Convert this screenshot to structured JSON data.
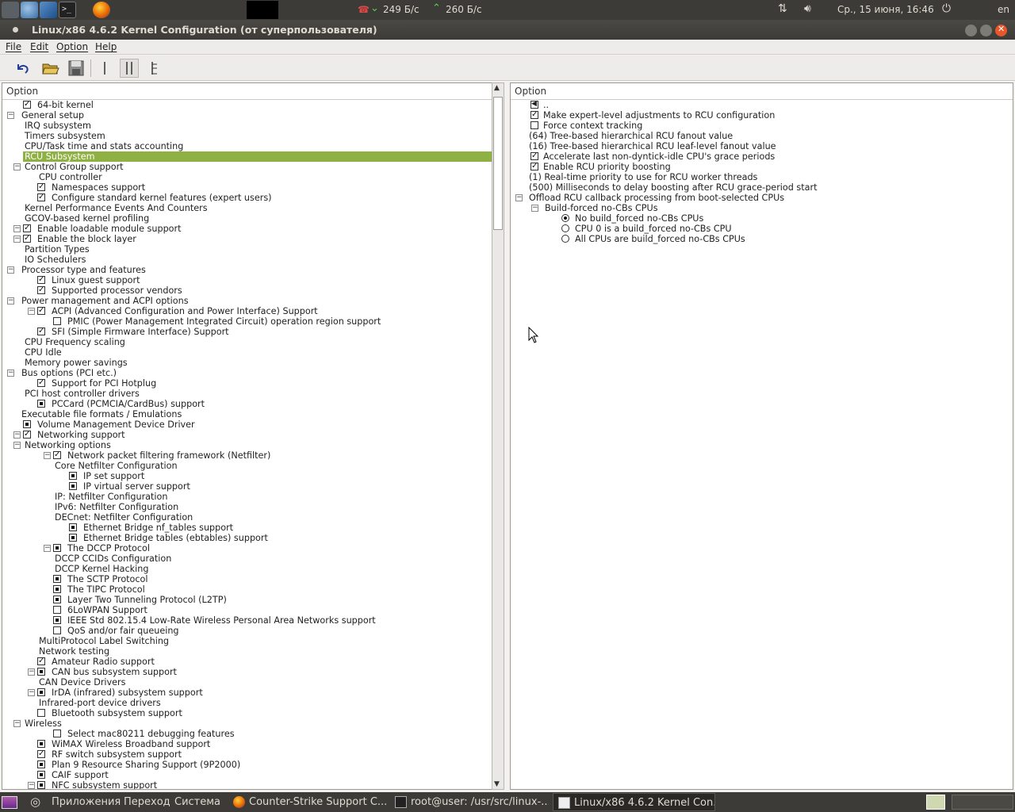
{
  "top_panel": {
    "net_down": "249 Б/с",
    "net_up": "260 Б/с",
    "datetime": "Ср., 15 июня, 16:46",
    "lang": "en",
    "launchers": [
      "steam-icon",
      "browser-icon",
      "virtualbox-icon",
      "terminal-icon",
      "firefox-icon"
    ]
  },
  "window": {
    "title": "Linux/x86 4.6.2 Kernel Configuration (от суперпользователя)"
  },
  "menu": {
    "file": "File",
    "edit": "Edit",
    "option": "Option",
    "help": "Help"
  },
  "toolbar": {
    "buttons": [
      "back-icon",
      "open-icon",
      "save-icon",
      "single-view-icon",
      "split-view-icon",
      "full-tree-icon"
    ]
  },
  "left_pane": {
    "header": "Option",
    "rows": [
      {
        "label": "64-bit kernel",
        "level": 1,
        "check": "on",
        "expander": null
      },
      {
        "label": "General setup",
        "level": 0,
        "check": null,
        "expander": "minus"
      },
      {
        "label": "IRQ subsystem",
        "level": 1,
        "check": null,
        "expander": null
      },
      {
        "label": "Timers subsystem",
        "level": 1,
        "check": null,
        "expander": null
      },
      {
        "label": "CPU/Task time and stats accounting",
        "level": 1,
        "check": null,
        "expander": null
      },
      {
        "label": "RCU Subsystem",
        "level": 1,
        "check": null,
        "expander": null,
        "selected": true
      },
      {
        "label": "Control Group support",
        "level": 1,
        "check": null,
        "expander": "minus"
      },
      {
        "label": "CPU controller",
        "level": 2,
        "check": null,
        "expander": null
      },
      {
        "label": "Namespaces support",
        "level": 2,
        "check": "on",
        "expander": null
      },
      {
        "label": "Configure standard kernel features (expert users)",
        "level": 2,
        "check": "on",
        "expander": null
      },
      {
        "label": "Kernel Performance Events And Counters",
        "level": 1,
        "check": null,
        "expander": null
      },
      {
        "label": "GCOV-based kernel profiling",
        "level": 1,
        "check": null,
        "expander": null
      },
      {
        "label": "Enable loadable module support",
        "level": 1,
        "check": "on",
        "expander": "minus"
      },
      {
        "label": "Enable the block layer",
        "level": 1,
        "check": "on",
        "expander": "minus"
      },
      {
        "label": "Partition Types",
        "level": 1,
        "check": null,
        "expander": null
      },
      {
        "label": "IO Schedulers",
        "level": 1,
        "check": null,
        "expander": null
      },
      {
        "label": "Processor type and features",
        "level": 0,
        "check": null,
        "expander": "minus"
      },
      {
        "label": "Linux guest support",
        "level": 2,
        "check": "on",
        "expander": null
      },
      {
        "label": "Supported processor vendors",
        "level": 2,
        "check": "on",
        "expander": null
      },
      {
        "label": "Power management and ACPI options",
        "level": 0,
        "check": null,
        "expander": "minus"
      },
      {
        "label": "ACPI (Advanced Configuration and Power Interface) Support",
        "level": 2,
        "check": "on",
        "expander": "minus"
      },
      {
        "label": "PMIC (Power Management Integrated Circuit) operation region support",
        "level": 3,
        "check": "off",
        "expander": null
      },
      {
        "label": "SFI (Simple Firmware Interface) Support",
        "level": 2,
        "check": "on",
        "expander": null
      },
      {
        "label": "CPU Frequency scaling",
        "level": 1,
        "check": null,
        "expander": null
      },
      {
        "label": "CPU Idle",
        "level": 1,
        "check": null,
        "expander": null
      },
      {
        "label": "Memory power savings",
        "level": 1,
        "check": null,
        "expander": null
      },
      {
        "label": "Bus options (PCI etc.)",
        "level": 0,
        "check": null,
        "expander": "minus"
      },
      {
        "label": "Support for PCI Hotplug",
        "level": 2,
        "check": "on",
        "expander": null
      },
      {
        "label": "PCI host controller drivers",
        "level": 1,
        "check": null,
        "expander": null
      },
      {
        "label": "PCCard (PCMCIA/CardBus) support",
        "level": 2,
        "check": "mod",
        "expander": null
      },
      {
        "label": "Executable file formats / Emulations",
        "level": 0,
        "check": null,
        "expander": null
      },
      {
        "label": "Volume Management Device Driver",
        "level": 1,
        "check": "mod",
        "expander": null
      },
      {
        "label": "Networking support",
        "level": 1,
        "check": "on",
        "expander": "minus"
      },
      {
        "label": "Networking options",
        "level": 1,
        "check": null,
        "expander": "minus"
      },
      {
        "label": "Network packet filtering framework (Netfilter)",
        "level": 3,
        "check": "on",
        "expander": "minus"
      },
      {
        "label": "Core Netfilter Configuration",
        "level": 3,
        "check": null,
        "expander": null
      },
      {
        "label": "IP set support",
        "level": 4,
        "check": "mod",
        "expander": null
      },
      {
        "label": "IP virtual server support",
        "level": 4,
        "check": "mod",
        "expander": null
      },
      {
        "label": "IP: Netfilter Configuration",
        "level": 3,
        "check": null,
        "expander": null
      },
      {
        "label": "IPv6: Netfilter Configuration",
        "level": 3,
        "check": null,
        "expander": null
      },
      {
        "label": "DECnet: Netfilter Configuration",
        "level": 3,
        "check": null,
        "expander": null
      },
      {
        "label": "Ethernet Bridge nf_tables support",
        "level": 4,
        "check": "mod",
        "expander": null
      },
      {
        "label": "Ethernet Bridge tables (ebtables) support",
        "level": 4,
        "check": "mod",
        "expander": null
      },
      {
        "label": "The DCCP Protocol",
        "level": 3,
        "check": "mod",
        "expander": "minus"
      },
      {
        "label": "DCCP CCIDs Configuration",
        "level": 3,
        "check": null,
        "expander": null
      },
      {
        "label": "DCCP Kernel Hacking",
        "level": 3,
        "check": null,
        "expander": null
      },
      {
        "label": "The SCTP Protocol",
        "level": 3,
        "check": "mod",
        "expander": null
      },
      {
        "label": "The TIPC Protocol",
        "level": 3,
        "check": "mod",
        "expander": null
      },
      {
        "label": "Layer Two Tunneling Protocol (L2TP)",
        "level": 3,
        "check": "mod",
        "expander": null
      },
      {
        "label": "6LoWPAN Support",
        "level": 3,
        "check": "off",
        "expander": null
      },
      {
        "label": "IEEE Std 802.15.4 Low-Rate Wireless Personal Area Networks support",
        "level": 3,
        "check": "mod",
        "expander": null
      },
      {
        "label": "QoS and/or fair queueing",
        "level": 3,
        "check": "off",
        "expander": null
      },
      {
        "label": "MultiProtocol Label Switching",
        "level": 2,
        "check": null,
        "expander": null
      },
      {
        "label": "Network testing",
        "level": 2,
        "check": null,
        "expander": null
      },
      {
        "label": "Amateur Radio support",
        "level": 2,
        "check": "on",
        "expander": null
      },
      {
        "label": "CAN bus subsystem support",
        "level": 2,
        "check": "mod",
        "expander": "minus"
      },
      {
        "label": "CAN Device Drivers",
        "level": 2,
        "check": null,
        "expander": null
      },
      {
        "label": "IrDA (infrared) subsystem support",
        "level": 2,
        "check": "mod",
        "expander": "minus"
      },
      {
        "label": "Infrared-port device drivers",
        "level": 2,
        "check": null,
        "expander": null
      },
      {
        "label": "Bluetooth subsystem support",
        "level": 2,
        "check": "off",
        "expander": null
      },
      {
        "label": "Wireless",
        "level": 1,
        "check": null,
        "expander": "minus"
      },
      {
        "label": "Select mac80211 debugging features",
        "level": 3,
        "check": "off",
        "expander": null
      },
      {
        "label": "WiMAX Wireless Broadband support",
        "level": 2,
        "check": "mod",
        "expander": null
      },
      {
        "label": "RF switch subsystem support",
        "level": 2,
        "check": "on",
        "expander": null
      },
      {
        "label": "Plan 9 Resource Sharing Support (9P2000)",
        "level": 2,
        "check": "mod",
        "expander": null
      },
      {
        "label": "CAIF support",
        "level": 2,
        "check": "mod",
        "expander": null
      },
      {
        "label": "NFC subsystem support",
        "level": 2,
        "check": "mod",
        "expander": "minus"
      }
    ]
  },
  "right_pane": {
    "header": "Option",
    "rows": [
      {
        "label": "..",
        "kind": "back"
      },
      {
        "label": "Make expert-level adjustments to RCU configuration",
        "kind": "check",
        "state": "on"
      },
      {
        "label": "Force context tracking",
        "kind": "check",
        "state": "off"
      },
      {
        "label": "(64) Tree-based hierarchical RCU fanout value",
        "kind": "text"
      },
      {
        "label": "(16) Tree-based hierarchical RCU leaf-level fanout value",
        "kind": "text"
      },
      {
        "label": "Accelerate last non-dyntick-idle CPU's grace periods",
        "kind": "check",
        "state": "on"
      },
      {
        "label": "Enable RCU priority boosting",
        "kind": "check",
        "state": "on"
      },
      {
        "label": "(1) Real-time priority to use for RCU worker threads",
        "kind": "text"
      },
      {
        "label": "(500) Milliseconds to delay boosting after RCU grace-period start",
        "kind": "text"
      },
      {
        "label": "Offload RCU callback processing from boot-selected CPUs",
        "kind": "group"
      },
      {
        "label": "Build-forced no-CBs CPUs",
        "kind": "subgroup"
      },
      {
        "label": "No build_forced no-CBs CPUs",
        "kind": "radio",
        "state": "on"
      },
      {
        "label": "CPU 0 is a build_forced no-CBs CPU",
        "kind": "radio",
        "state": "off"
      },
      {
        "label": "All CPUs are build_forced no-CBs CPUs",
        "kind": "radio",
        "state": "off"
      }
    ]
  },
  "bottom_panel": {
    "apps": "Приложения",
    "places": "Переход",
    "system": "Система",
    "tasks": [
      {
        "label": "Counter-Strike Support C...",
        "icon": "firefox-icon",
        "active": false
      },
      {
        "label": "root@user: /usr/src/linux-...",
        "icon": "terminal-icon",
        "active": false
      },
      {
        "label": "Linux/x86 4.6.2 Kernel Con...",
        "icon": "window-icon",
        "active": true
      }
    ]
  },
  "colors": {
    "selection": "#8fb144",
    "panel": "#3c3b37",
    "close_button": "#e8562a"
  }
}
